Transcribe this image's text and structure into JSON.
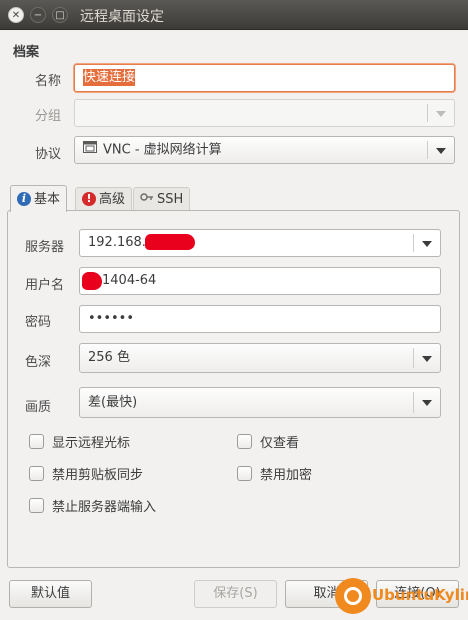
{
  "window": {
    "title": "远程桌面设定"
  },
  "profile_section": {
    "title": "档案"
  },
  "name_row": {
    "label": "名称",
    "value": "快速连接"
  },
  "group_row": {
    "label": "分组",
    "value": ""
  },
  "protocol_row": {
    "label": "协议",
    "value": "VNC - 虚拟网络计算"
  },
  "tabs": [
    {
      "label": "基本",
      "icon": "info-icon",
      "active": true
    },
    {
      "label": "高级",
      "icon": "warning-icon",
      "active": false
    },
    {
      "label": "SSH",
      "icon": "key-icon",
      "active": false
    }
  ],
  "basic": {
    "server": {
      "label": "服务器",
      "value": "192.168.1"
    },
    "username": {
      "label": "用户名",
      "value": "1404-64"
    },
    "password": {
      "label": "密码",
      "value": "••••••"
    },
    "color_depth": {
      "label": "色深",
      "value": "256 色"
    },
    "quality": {
      "label": "画质",
      "value": "差(最快)"
    },
    "checkboxes": {
      "show_remote_cursor": "显示远程光标",
      "view_only": "仅查看",
      "disable_clipboard_sync": "禁用剪贴板同步",
      "disable_encryption": "禁用加密",
      "disable_server_input": "禁止服务器端输入"
    }
  },
  "buttons": {
    "default": "默认值",
    "save": "保存(S)",
    "cancel": "取消",
    "connect": "连接(O)"
  },
  "watermark": {
    "text": "UbuntuKylin"
  },
  "colors": {
    "accent": "#e46d3b",
    "titlebar": "#3c3b37",
    "watermark": "#f08a1e"
  }
}
